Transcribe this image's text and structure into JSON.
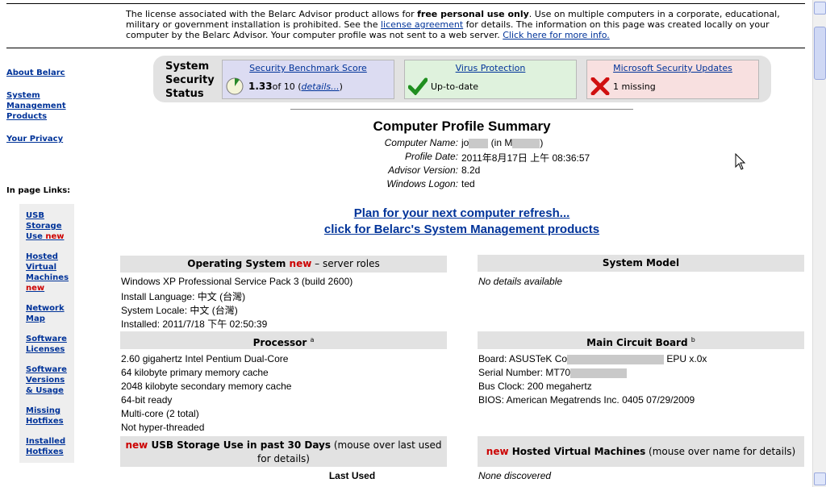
{
  "top_note": {
    "part1": "The license associated with the Belarc Advisor product allows for ",
    "bold": "free personal use only",
    "part2": ".  Use on multiple computers in a corporate, educational, military or government installation is prohibited.  See the ",
    "license_link": "license agreement",
    "part3": " for details.  The information on this page was created locally on your computer by the Belarc Advisor.  Your computer profile was not sent to a web server.  ",
    "more_link": "Click here for more info."
  },
  "sidebar": {
    "about": "About Belarc",
    "system_mgmt": "System Management Products",
    "privacy": "Your Privacy",
    "in_page_heading": "In page Links:",
    "links": [
      {
        "label": "USB Storage Use",
        "new": "new"
      },
      {
        "label": "Hosted Virtual Machines",
        "new": "new"
      },
      {
        "label": "Network Map"
      },
      {
        "label": "Software Licenses"
      },
      {
        "label": "Software Versions & Usage"
      },
      {
        "label": "Missing Hotfixes"
      },
      {
        "label": "Installed Hotfixes"
      }
    ]
  },
  "status": {
    "label": "System Security Status",
    "benchmark": {
      "title": "Security Benchmark Score",
      "score": "1.33",
      "of": " of 10 (",
      "details": "details...",
      "close": ")"
    },
    "virus": {
      "title": "Virus Protection",
      "text": "Up-to-date"
    },
    "updates": {
      "title": "Microsoft Security Updates",
      "text": "1 missing"
    }
  },
  "summary": {
    "title": "Computer Profile Summary",
    "rows": [
      {
        "label": "Computer Name:",
        "value": "jo",
        "suffix": " (in M",
        "suffix_end": ")"
      },
      {
        "label": "Profile Date:",
        "value": "2011年8月17日 上午 08:36:57"
      },
      {
        "label": "Advisor Version:",
        "value": "8.2d"
      },
      {
        "label": "Windows Logon:",
        "value": "ted"
      }
    ]
  },
  "promo": {
    "line1": "Plan for your next computer refresh...",
    "line2": "click for Belarc's System Management products"
  },
  "os": {
    "heading": "Operating System",
    "new": "new",
    "suffix": " – server roles",
    "lines": [
      "Windows XP Professional Service Pack 3 (build 2600)",
      "Install Language: 中文 (台灣)",
      "System Locale: 中文 (台灣)",
      "Installed: 2011/7/18 下午 02:50:39"
    ]
  },
  "system_model": {
    "heading": "System Model",
    "text": "No details available"
  },
  "processor": {
    "heading": "Processor",
    "sup": "a",
    "lines": [
      "2.60 gigahertz Intel Pentium Dual-Core",
      "64 kilobyte primary memory cache",
      "2048 kilobyte secondary memory cache",
      "64-bit ready",
      "Multi-core (2 total)",
      "Not hyper-threaded"
    ]
  },
  "board": {
    "heading": "Main Circuit Board",
    "sup": "b",
    "board_prefix": "Board: ASUSTeK Co",
    "board_suffix": " EPU x.0x",
    "serial_prefix": "Serial Number: MT70",
    "lines": [
      "Bus Clock: 200 megahertz",
      "BIOS: American Megatrends Inc. 0405 07/29/2009"
    ]
  },
  "usb": {
    "new": "new",
    "heading": "USB Storage Use in past 30 Days",
    "note": " (mouse over last used for details)",
    "column": "Last Used"
  },
  "vm": {
    "new": "new",
    "heading": "Hosted Virtual Machines",
    "note": " (mouse over name for details)",
    "text": "None discovered"
  },
  "icons": {
    "benchmark": "pie-gauge-icon",
    "virus": "green-check-icon",
    "updates": "red-x-icon"
  },
  "colors": {
    "link": "#003399",
    "new": "#cc0000",
    "section_header": "#e2e2e2"
  }
}
